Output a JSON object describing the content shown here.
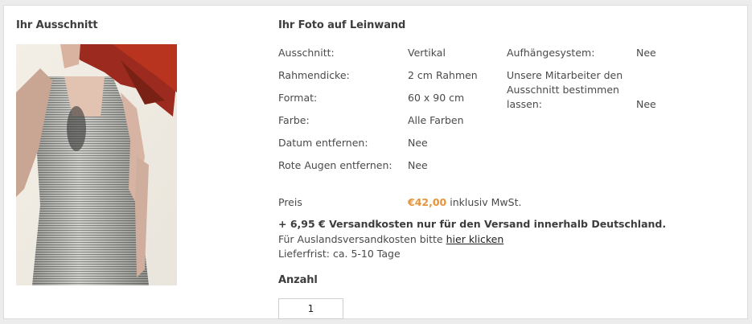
{
  "left": {
    "heading": "Ihr Ausschnitt"
  },
  "right": {
    "heading": "Ihr Foto auf Leinwand",
    "details_col1": [
      {
        "label": "Ausschnitt:",
        "value": "Vertikal"
      },
      {
        "label": "Rahmendicke:",
        "value": "2 cm Rahmen"
      },
      {
        "label": "Format:",
        "value": "60 x 90 cm"
      },
      {
        "label": "Farbe:",
        "value": "Alle Farben"
      },
      {
        "label": "Datum entfernen:",
        "value": "Nee"
      },
      {
        "label": "Rote Augen entfernen:",
        "value": "Nee"
      }
    ],
    "details_col2": [
      {
        "label": "Aufhängesystem:",
        "value": "Nee"
      },
      {
        "label_lines": [
          "Unsere Mitarbeiter den",
          "Ausschnitt bestimmen",
          "lassen:"
        ],
        "value": "Nee"
      }
    ],
    "price": {
      "label": "Preis",
      "amount": "€42,00",
      "suffix": "inklusiv MwSt."
    },
    "shipping": {
      "bold": "+ 6,95 € Versandkosten nur für den Versand innerhalb Deutschland.",
      "abroad_text": "Für Auslandsversandkosten bitte",
      "abroad_link": "hier klicken",
      "delivery": "Lieferfrist: ca. 5-10 Tage"
    },
    "quantity": {
      "heading": "Anzahl",
      "value": "1"
    }
  },
  "colors": {
    "price": "#e8923a",
    "background": "#ececec",
    "panel": "#ffffff"
  }
}
